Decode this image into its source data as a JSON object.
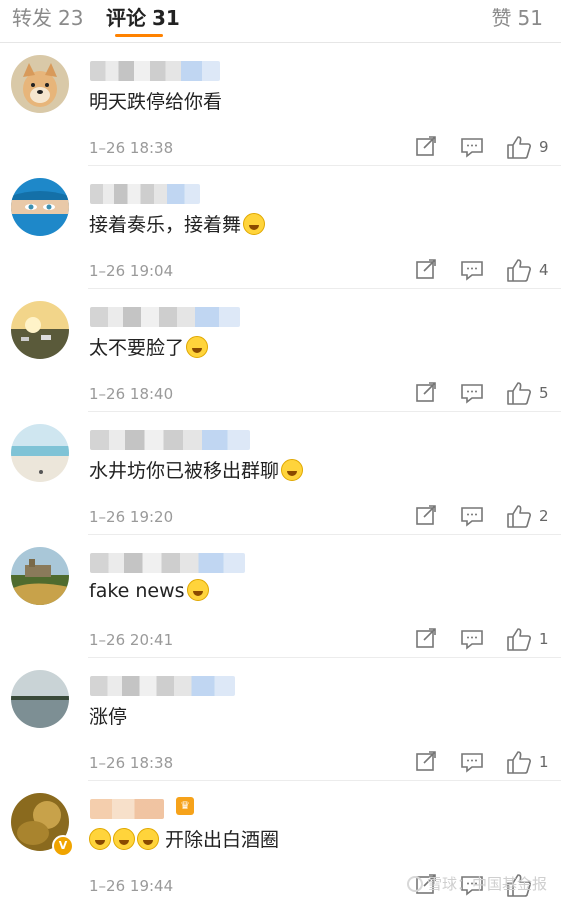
{
  "tabs": {
    "repost": {
      "label": "转发",
      "count": "23"
    },
    "comment": {
      "label": "评论",
      "count": "31"
    },
    "like": {
      "label": "赞",
      "count": "51"
    }
  },
  "accent_color": "#ff8200",
  "comments": [
    {
      "text": "明天跌停给你看",
      "emoji": "",
      "time": "1–26 18:38",
      "likes": "9",
      "avatar": "dog-avatar"
    },
    {
      "text": "接着奏乐，接着舞",
      "emoji": "grin-emoji",
      "time": "1–26 19:04",
      "likes": "4",
      "avatar": "veiled-eyes-avatar"
    },
    {
      "text": "太不要脸了",
      "emoji": "laugh-cry-emoji",
      "time": "1–26 18:40",
      "likes": "5",
      "avatar": "sunset-landscape-avatar"
    },
    {
      "text": "水井坊你已被移出群聊",
      "emoji": "laugh-cry-emoji",
      "time": "1–26 19:20",
      "likes": "2",
      "avatar": "beach-avatar"
    },
    {
      "text": "fake news",
      "emoji": "laugh-cry-emoji",
      "time": "1–26 20:41",
      "likes": "1",
      "avatar": "castle-hill-avatar"
    },
    {
      "text": "涨停",
      "emoji": "",
      "time": "1–26 18:38",
      "likes": "1",
      "avatar": "lake-avatar"
    },
    {
      "text": "开除出白酒圈",
      "emoji": "three-emoji-prefix",
      "time": "1–26 19:44",
      "likes": "",
      "avatar": "golden-avatar"
    }
  ],
  "watermark": "雪球：中国基金报"
}
